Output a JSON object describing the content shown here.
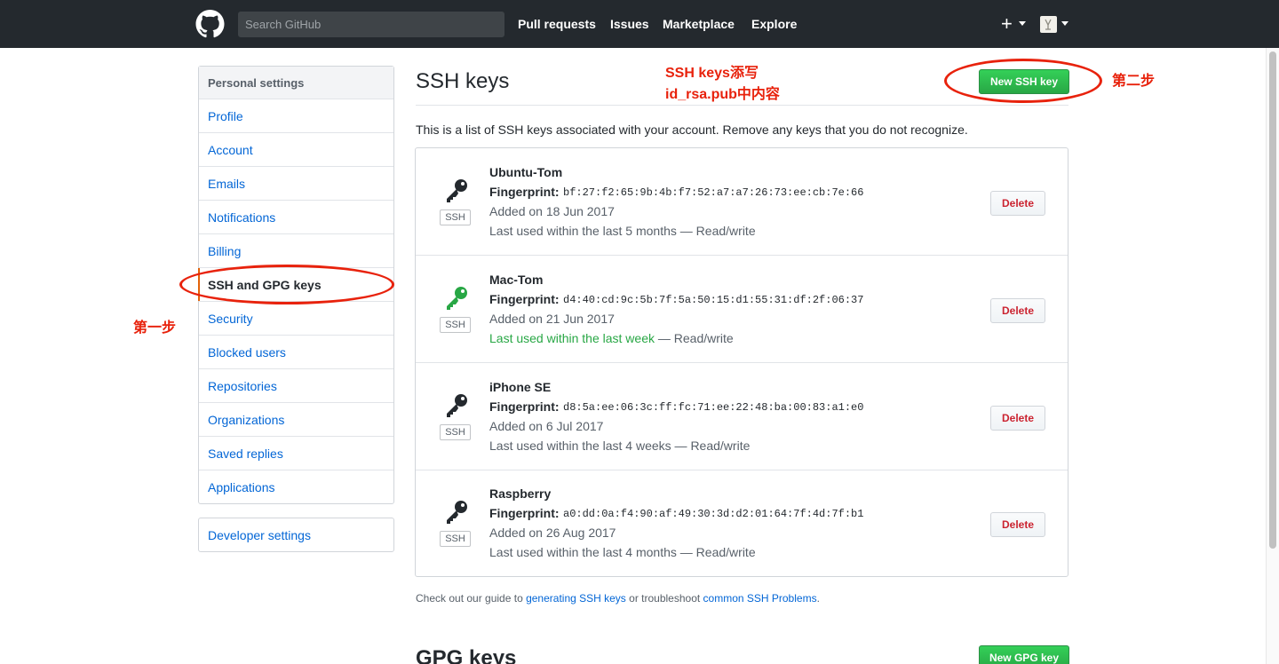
{
  "header": {
    "search_placeholder": "Search GitHub",
    "nav": [
      "Pull requests",
      "Issues",
      "Marketplace",
      "Explore"
    ],
    "plus_label": "+"
  },
  "sidebar": {
    "heading": "Personal settings",
    "items": [
      {
        "label": "Profile"
      },
      {
        "label": "Account"
      },
      {
        "label": "Emails"
      },
      {
        "label": "Notifications"
      },
      {
        "label": "Billing"
      },
      {
        "label": "SSH and GPG keys",
        "selected": true
      },
      {
        "label": "Security"
      },
      {
        "label": "Blocked users"
      },
      {
        "label": "Repositories"
      },
      {
        "label": "Organizations"
      },
      {
        "label": "Saved replies"
      },
      {
        "label": "Applications"
      }
    ],
    "developer": "Developer settings"
  },
  "main": {
    "title": "SSH keys",
    "new_ssh_button": "New SSH key",
    "intro": "This is a list of SSH keys associated with your account. Remove any keys that you do not recognize.",
    "fingerprint_label": "Fingerprint:",
    "badge": "SSH",
    "delete_label": "Delete",
    "keys": [
      {
        "name": "Ubuntu-Tom",
        "fingerprint": "bf:27:f2:65:9b:4b:f7:52:a7:a7:26:73:ee:cb:7e:66",
        "added": "Added on 18 Jun 2017",
        "last_used": "Last used within the last 5 months",
        "access": " — Read/write",
        "recent": false,
        "icon_color": "#24292e"
      },
      {
        "name": "Mac-Tom",
        "fingerprint": "d4:40:cd:9c:5b:7f:5a:50:15:d1:55:31:df:2f:06:37",
        "added": "Added on 21 Jun 2017",
        "last_used": "Last used within the last week",
        "access": " — Read/write",
        "recent": true,
        "icon_color": "#28a745"
      },
      {
        "name": "iPhone SE",
        "fingerprint": "d8:5a:ee:06:3c:ff:fc:71:ee:22:48:ba:00:83:a1:e0",
        "added": "Added on 6 Jul 2017",
        "last_used": "Last used within the last 4 weeks",
        "access": " — Read/write",
        "recent": false,
        "icon_color": "#24292e"
      },
      {
        "name": "Raspberry",
        "fingerprint": "a0:dd:0a:f4:90:af:49:30:3d:d2:01:64:7f:4d:7f:b1",
        "added": "Added on 26 Aug 2017",
        "last_used": "Last used within the last 4 months",
        "access": " — Read/write",
        "recent": false,
        "icon_color": "#24292e"
      }
    ],
    "guide": {
      "prefix": "Check out our guide to ",
      "link1": "generating SSH keys",
      "middle": " or troubleshoot ",
      "link2": "common SSH Problems",
      "suffix": "."
    },
    "gpg_title": "GPG keys",
    "new_gpg_button": "New GPG key"
  },
  "annotations": {
    "note_line1": "SSH keys添写",
    "note_line2": "id_rsa.pub中内容",
    "step1": "第一步",
    "step2": "第二步",
    "color": "#e8220c"
  }
}
